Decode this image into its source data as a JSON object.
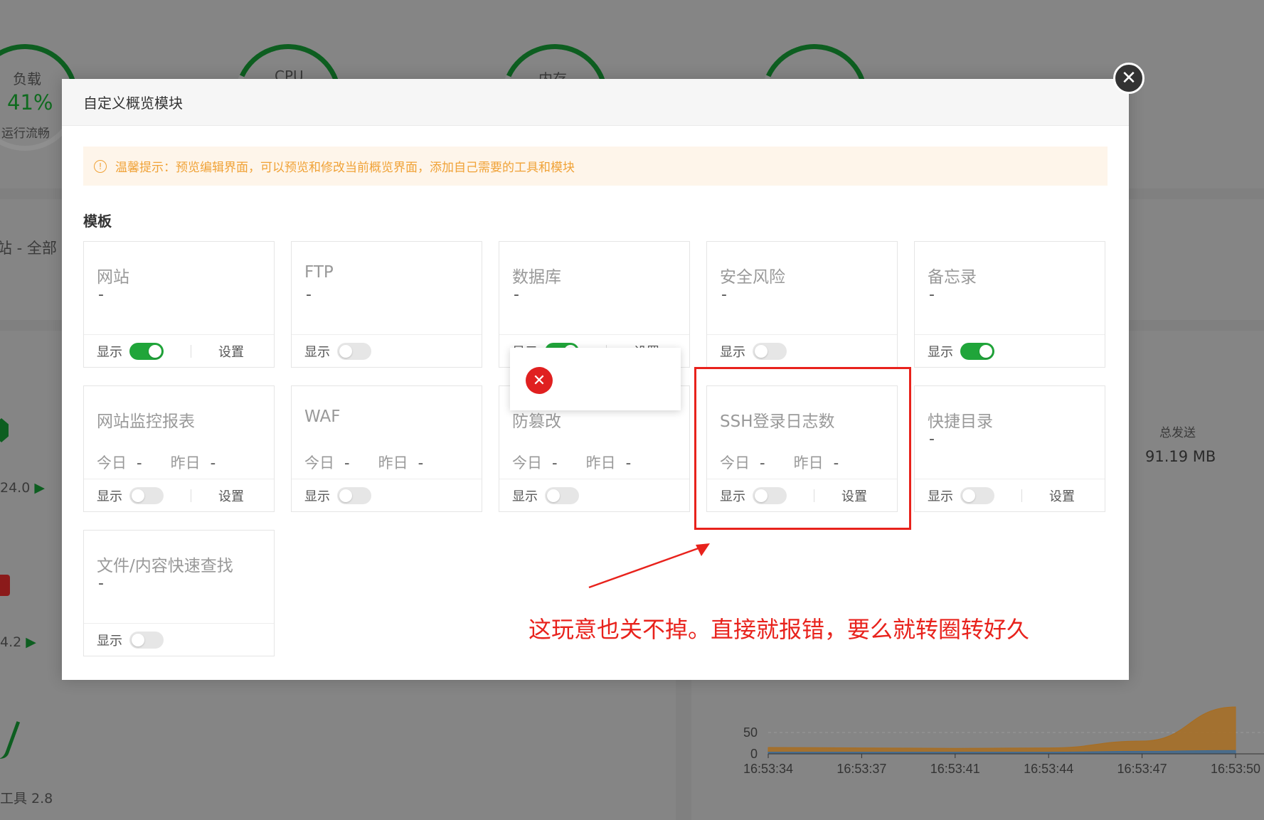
{
  "background": {
    "load": {
      "label": "负载",
      "percent": "41%",
      "status": "运行流畅"
    },
    "gauges": {
      "cpu": "CPU",
      "memory": "内存"
    },
    "site_filter": "站 - 全部",
    "versions": [
      "24.0",
      "4.2",
      "工具 2.8"
    ],
    "total_sent_label": "总发送",
    "total_sent_value": "91.19 MB",
    "chart_data": {
      "type": "area",
      "x": [
        "16:53:34",
        "16:53:37",
        "16:53:41",
        "16:53:44",
        "16:53:47",
        "16:53:50"
      ],
      "yticks": [
        "0",
        "50"
      ],
      "series": [
        {
          "values": [
            15,
            14,
            13,
            14,
            30,
            110
          ],
          "color": "#a86d21"
        },
        {
          "values": [
            4,
            4,
            4,
            4,
            6,
            8
          ],
          "color": "#3c6b99"
        }
      ],
      "ylim": [
        0,
        150
      ]
    }
  },
  "modal": {
    "title": "自定义概览模块",
    "tip": "温馨提示：预览编辑界面，可以预览和修改当前概览界面，添加自己需要的工具和模块",
    "section_title": "模板",
    "show_label": "显示",
    "settings_label": "设置",
    "today_label": "今日",
    "yesterday_label": "昨日",
    "dash": "-",
    "cards": [
      {
        "name": "网站",
        "type": "simple",
        "on": true,
        "settings": true
      },
      {
        "name": "FTP",
        "type": "simple",
        "on": false,
        "settings": false
      },
      {
        "name": "数据库",
        "type": "simple",
        "on": true,
        "settings": true
      },
      {
        "name": "安全风险",
        "type": "simple",
        "on": false,
        "settings": false
      },
      {
        "name": "备忘录",
        "type": "simple",
        "on": true,
        "settings": false
      },
      {
        "name": "网站监控报表",
        "type": "stats",
        "on": false,
        "settings": true
      },
      {
        "name": "WAF",
        "type": "stats",
        "on": false,
        "settings": false
      },
      {
        "name": "防篡改",
        "type": "stats",
        "on": false,
        "settings": false
      },
      {
        "name": "SSH登录日志数",
        "type": "stats",
        "on": false,
        "settings": true
      },
      {
        "name": "快捷目录",
        "type": "simple",
        "on": false,
        "settings": true
      },
      {
        "name": "文件/内容快速查找",
        "type": "simple",
        "on": false,
        "settings": false
      }
    ],
    "error_icon": "x-icon"
  },
  "annotation": "这玩意也关不掉。直接就报错，要么就转圈转好久",
  "colors": {
    "toggle_on": "#20a53a",
    "annotation_red": "#e8221c",
    "tip_orange": "#f0a237"
  }
}
